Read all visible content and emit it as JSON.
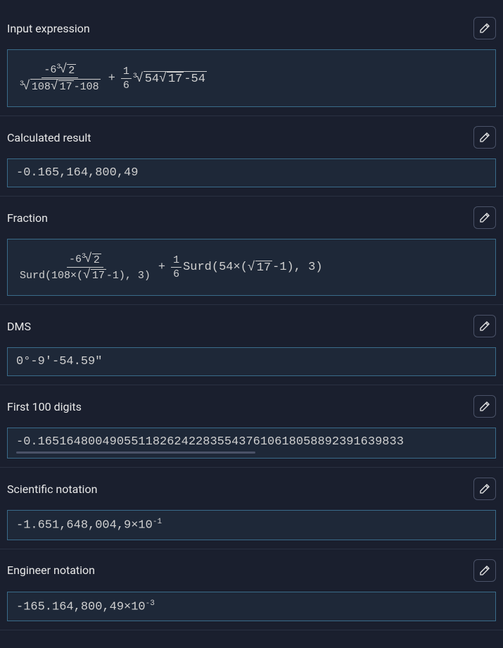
{
  "sections": {
    "input": {
      "title": "Input expression"
    },
    "calculated": {
      "title": "Calculated result",
      "value": "-0.165,164,800,49"
    },
    "fraction": {
      "title": "Fraction"
    },
    "dms": {
      "title": "DMS",
      "value": "0°-9'-54.59\""
    },
    "digits": {
      "title": "First 100 digits",
      "value": "-0.165164800490551182624228355437610618058892391639833"
    },
    "scientific": {
      "title": "Scientific notation",
      "mantissa": "-1.651,648,004,9×10",
      "exp": "-1"
    },
    "engineer": {
      "title": "Engineer notation",
      "mantissa": "-165.164,800,49×10",
      "exp": "-3"
    }
  },
  "math": {
    "input_num": "-6",
    "input_cuberoot_2": "2",
    "input_den_108": "108",
    "input_den_17": "17",
    "input_den_minus_108": "-108",
    "frac_1": "1",
    "frac_6": "6",
    "inner_54": "54",
    "inner_17": "17",
    "inner_minus_54": "-54",
    "surd_label_1": "Surd(108×(",
    "surd_tail_1": "-1), 3)",
    "surd_label_2": "Surd(54×(",
    "surd_tail_2": "-1), 3)",
    "plus": "+"
  },
  "chart_data": {
    "type": "table",
    "title": "Number format representations",
    "categories": [
      "Calculated result",
      "DMS",
      "First 100 digits",
      "Scientific notation",
      "Engineer notation"
    ],
    "values": [
      "-0.165,164,800,49",
      "0°-9'-54.59\"",
      "-0.165164800490551182624228355437610618058892391639833",
      "-1.651,648,004,9×10^-1",
      "-165.164,800,49×10^-3"
    ]
  }
}
